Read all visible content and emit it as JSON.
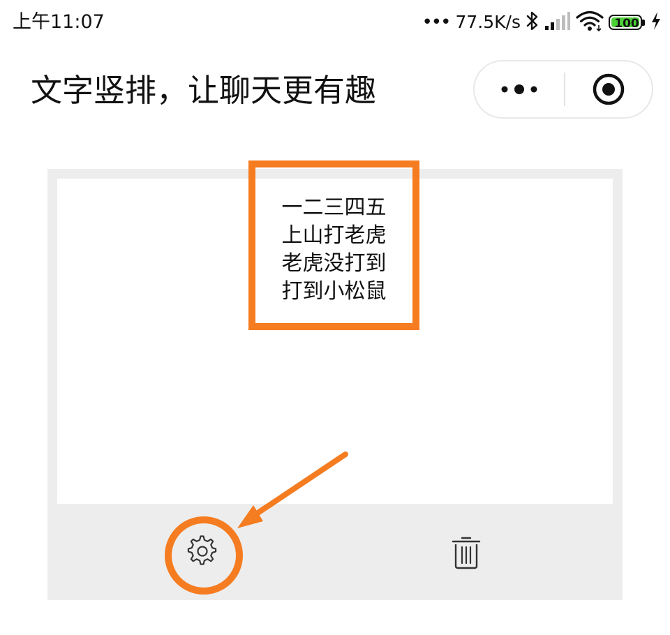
{
  "status_bar": {
    "time": "上午11:07",
    "network_speed": "77.5K/s",
    "battery_level": "100",
    "icons": [
      "bluetooth-icon",
      "signal-icon",
      "wifi-icon",
      "battery-icon",
      "charging-icon"
    ]
  },
  "header": {
    "title": "文字竖排，让聊天更有趣",
    "capsule_icons": [
      "more-icon",
      "close-target-icon"
    ]
  },
  "editor": {
    "text_lines": [
      "一二三四五",
      "上山打老虎",
      "老虎没打到",
      "打到小松鼠"
    ],
    "toolbar_icons": [
      "gear-icon",
      "trash-icon"
    ]
  },
  "colors": {
    "highlight": "#f57c20",
    "card_background": "#ededed",
    "battery_fill": "#4cd137"
  }
}
